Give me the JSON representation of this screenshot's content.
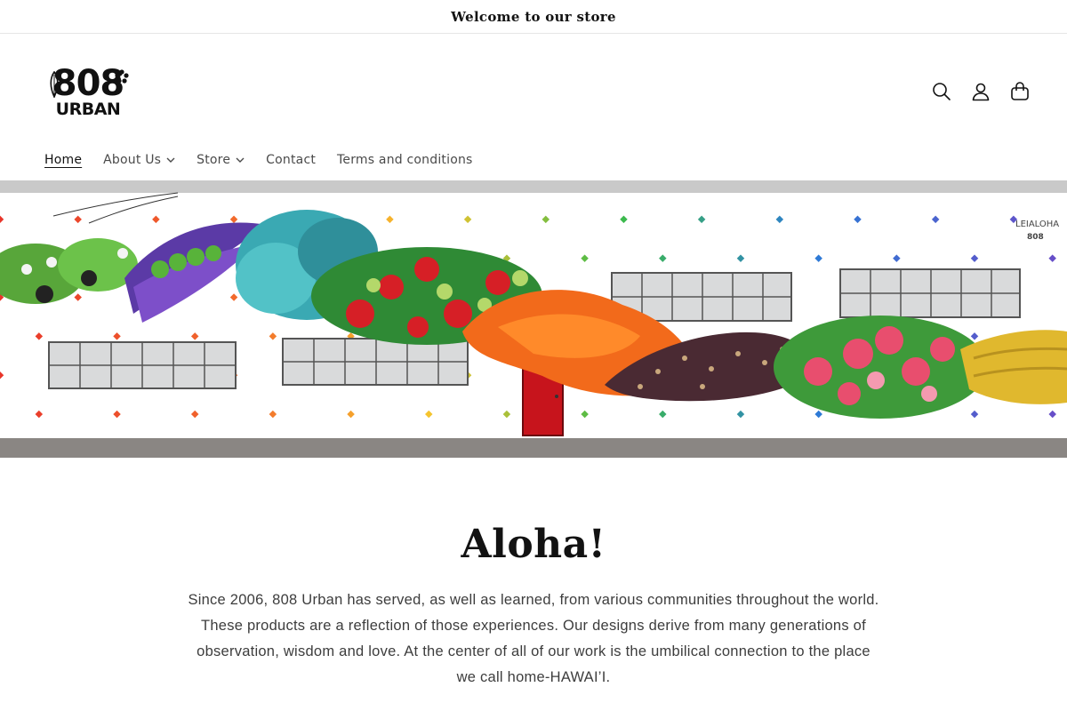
{
  "announcement": {
    "text": "Welcome to our store"
  },
  "logo": {
    "line1": "808",
    "line2": "URBAN"
  },
  "header_icons": [
    "search-icon",
    "account-icon",
    "cart-icon"
  ],
  "nav": {
    "items": [
      {
        "label": "Home",
        "active": true,
        "dropdown": false
      },
      {
        "label": "About Us",
        "active": false,
        "dropdown": true
      },
      {
        "label": "Store",
        "active": false,
        "dropdown": true
      },
      {
        "label": "Contact",
        "active": false,
        "dropdown": false
      },
      {
        "label": "Terms and conditions",
        "active": false,
        "dropdown": false
      }
    ]
  },
  "hero": {
    "mural_signature": "LEIALOHA",
    "mural_mark": "808"
  },
  "main": {
    "heading": "Aloha!",
    "paragraph": "Since 2006, 808 Urban has served, as well as learned, from various communities throughout the world. These products are a reflection of those experiences. Our designs derive from many generations of observation, wisdom and love. At the center of all of our work is the umbilical connection to the place we call home-HAWAI’I."
  },
  "colors": {
    "text": "#121212",
    "muted_text": "#3d3d3d",
    "border": "#e6e6e6",
    "background": "#ffffff"
  }
}
